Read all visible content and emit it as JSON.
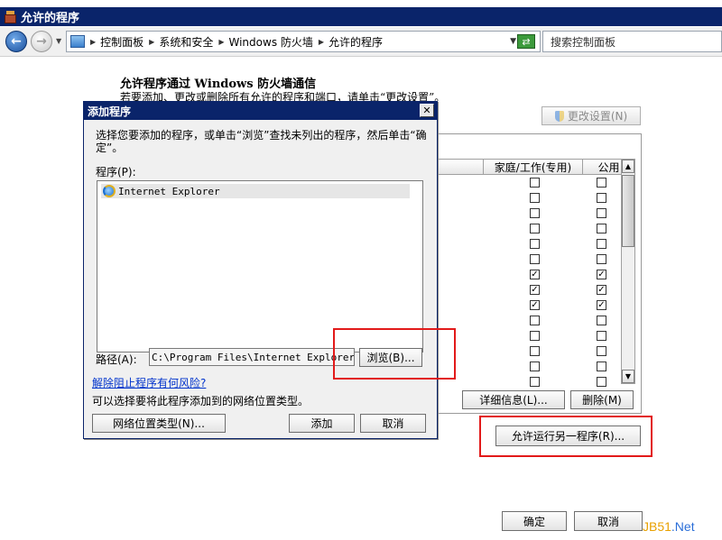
{
  "window": {
    "title": "允许的程序"
  },
  "address_bar": {
    "breadcrumbs": [
      "控制面板",
      "系统和安全",
      "Windows 防火墙",
      "允许的程序"
    ],
    "search_placeholder": "搜索控制面板"
  },
  "main": {
    "heading": "允许程序通过 Windows 防火墙通信",
    "description": "若要添加、更改或删除所有允许的程序和端口，请单击“更改设置”。",
    "change_settings_label": "更改设置(N)",
    "columns": {
      "home_work": "家庭/工作(专用)",
      "public": "公用"
    },
    "rules": [
      {
        "home": false,
        "public": false
      },
      {
        "home": false,
        "public": false
      },
      {
        "home": false,
        "public": false
      },
      {
        "home": false,
        "public": false
      },
      {
        "home": false,
        "public": false
      },
      {
        "home": false,
        "public": false
      },
      {
        "home": true,
        "public": true
      },
      {
        "home": true,
        "public": true
      },
      {
        "home": true,
        "public": true
      },
      {
        "home": false,
        "public": false
      },
      {
        "home": false,
        "public": false
      },
      {
        "home": false,
        "public": false
      },
      {
        "home": false,
        "public": false
      },
      {
        "home": false,
        "public": false
      }
    ],
    "details_label": "详细信息(L)...",
    "delete_label": "删除(M)",
    "allow_another_label": "允许运行另一程序(R)...",
    "ok_label": "确定",
    "cancel_label": "取消"
  },
  "dialog": {
    "title": "添加程序",
    "instruction": "选择您要添加的程序，或单击“浏览”查找未列出的程序，然后单击“确定”。",
    "program_label": "程序(P):",
    "programs": [
      "Internet Explorer"
    ],
    "path_label": "路径(A):",
    "path_value": "C:\\Program Files\\Internet Explorer\\ie",
    "browse_label": "浏览(B)...",
    "risk_link": "解除阻止程序有何风险?",
    "location_desc": "可以选择要将此程序添加到的网络位置类型。",
    "network_location_label": "网络位置类型(N)...",
    "add_label": "添加",
    "cancel_label": "取消"
  },
  "watermark": {
    "part1": "JB51",
    "part2": ".Net"
  }
}
